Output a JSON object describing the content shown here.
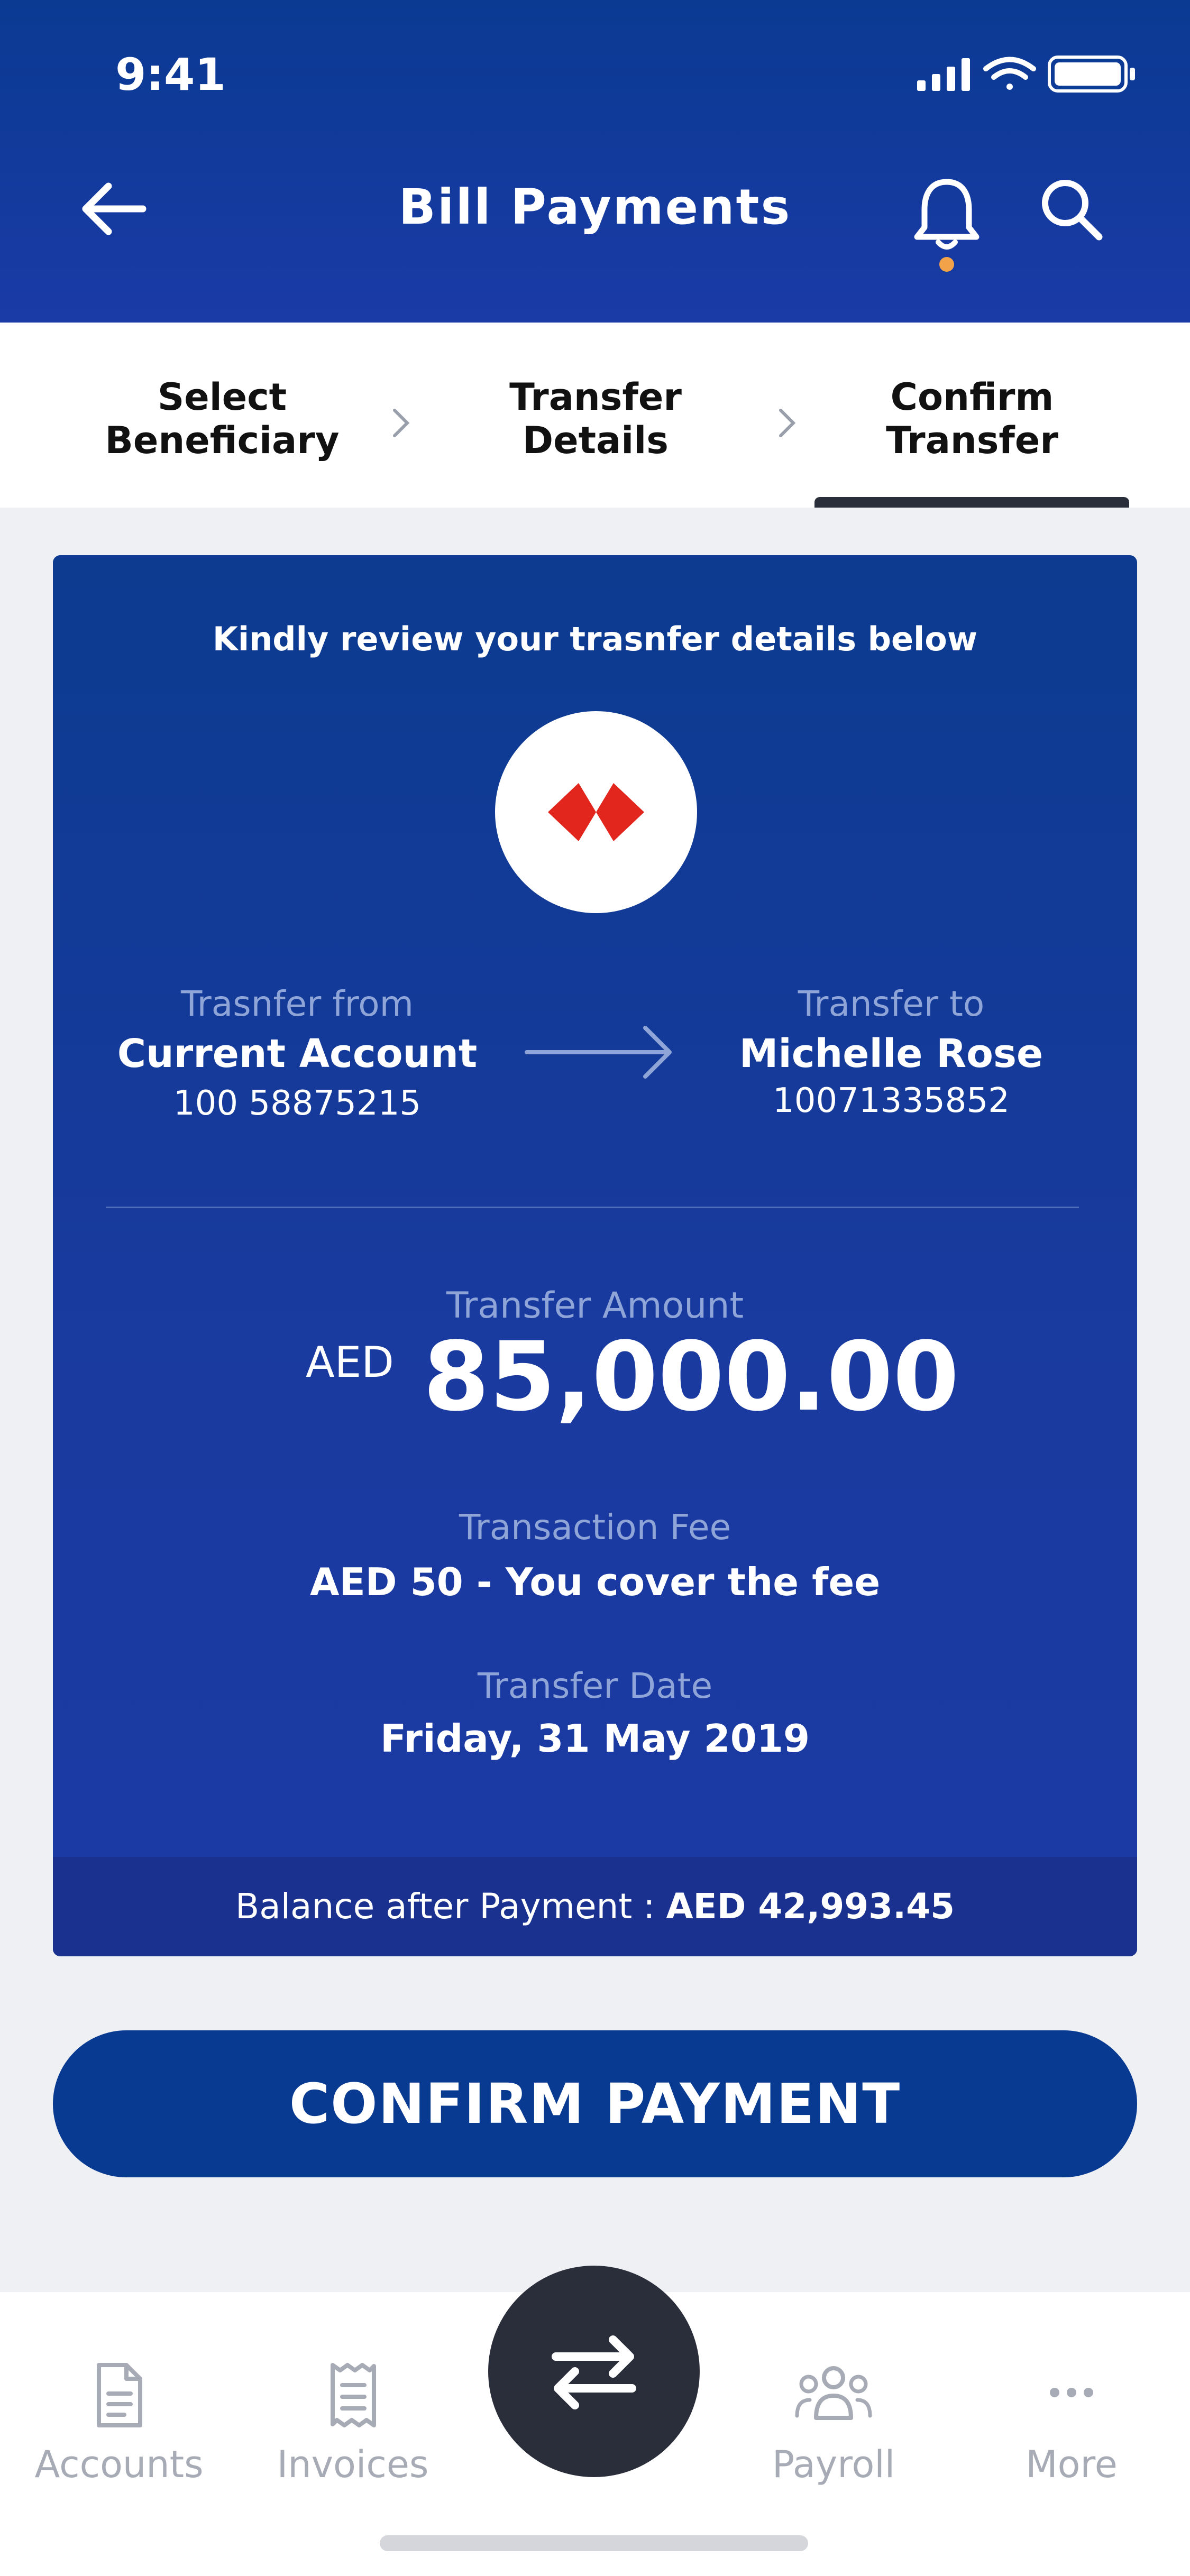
{
  "status_bar": {
    "time": "9:41"
  },
  "header": {
    "title": "Bill Payments"
  },
  "colors": {
    "primary": "#0a3a92",
    "card": "#1a3aa0",
    "accent_dot": "#f2a34a",
    "logo_red": "#e2261d",
    "dark": "#2a2e3a"
  },
  "steps": [
    {
      "line1": "Select",
      "line2": "Beneficiary"
    },
    {
      "line1": "Transfer",
      "line2": "Details"
    },
    {
      "line1": "Confirm",
      "line2": "Transfer"
    }
  ],
  "active_step_index": 2,
  "review": {
    "intro": "Kindly review your trasnfer details below",
    "from": {
      "label": "Trasnfer from",
      "name": "Current Account",
      "number": "100 58875215"
    },
    "to": {
      "label": "Transfer to",
      "name": "Michelle Rose",
      "number": "10071335852"
    },
    "amount": {
      "label": "Transfer Amount",
      "currency": "AED",
      "value": "85,000.00"
    },
    "fee": {
      "label": "Transaction Fee",
      "value": "AED 50 - You cover the fee"
    },
    "date": {
      "label": "Transfer Date",
      "value": "Friday, 31 May 2019"
    },
    "balance": {
      "label": "Balance after Payment :",
      "value": "AED 42,993.45"
    }
  },
  "confirm_button": {
    "label": "CONFIRM PAYMENT"
  },
  "tabbar": {
    "items": [
      {
        "label": "Accounts",
        "icon": "document-icon"
      },
      {
        "label": "Invoices",
        "icon": "receipt-icon"
      },
      {
        "label": "Payroll",
        "icon": "people-icon"
      },
      {
        "label": "More",
        "icon": "more-dots-icon"
      }
    ],
    "center": {
      "icon": "transfer-arrows-icon"
    }
  }
}
